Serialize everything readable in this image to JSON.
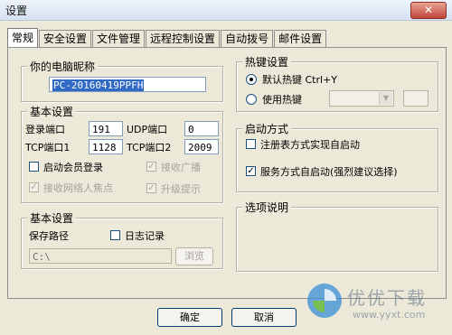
{
  "window": {
    "title": "设置",
    "close_glyph": "✕"
  },
  "tabs": [
    "常规",
    "安全设置",
    "文件管理",
    "远程控制设置",
    "自动拨号",
    "邮件设置"
  ],
  "nickname": {
    "group_label": "你的电脑昵称",
    "value": "PC-20160419PPFH"
  },
  "basic": {
    "group_label": "基本设置",
    "login_port_label": "登录端口",
    "login_port_value": "191",
    "udp_port_label": "UDP端口",
    "udp_port_value": "0",
    "tcp1_label": "TCP端口1",
    "tcp1_value": "1128",
    "tcp2_label": "TCP端口2",
    "tcp2_value": "2009",
    "member_login_label": "启动会员登录",
    "receive_broadcast_label": "接收广播",
    "receive_lan_label": "接收网络人焦点",
    "upgrade_hint_label": "升级提示"
  },
  "save": {
    "group_label": "基本设置",
    "path_label": "保存路径",
    "log_label": "日志记录",
    "path_value": "C:\\",
    "browse_label": "浏览"
  },
  "hotkey": {
    "group_label": "热键设置",
    "default_label": "默认热键 Ctrl+Y",
    "use_label": "使用热键"
  },
  "startup": {
    "group_label": "启动方式",
    "registry_label": "注册表方式实现自启动",
    "service_label": "服务方式自启动(强烈建议选择)"
  },
  "options": {
    "group_label": "选项说明"
  },
  "footer": {
    "ok_label": "确定",
    "cancel_label": "取消"
  },
  "watermark": {
    "text": "优优下载",
    "url": "www.yyxt.com"
  },
  "colors": {
    "accent": "#316ac5",
    "watermark_blue": "#3a8fd6",
    "watermark_green": "#7cc242"
  }
}
